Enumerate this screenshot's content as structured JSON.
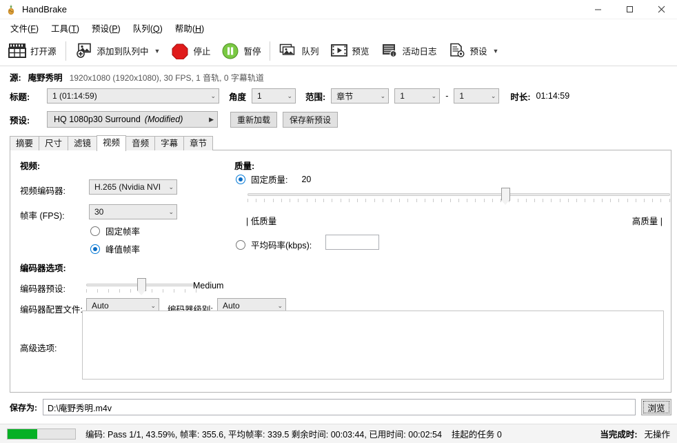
{
  "window": {
    "title": "HandBrake",
    "icon": "handbrake-pineapple-icon",
    "minimize": "—",
    "maximize": "☐",
    "close": "✕"
  },
  "menubar": [
    {
      "label": "文件",
      "accel": "F"
    },
    {
      "label": "工具",
      "accel": "T"
    },
    {
      "label": "预设",
      "accel": "P"
    },
    {
      "label": "队列",
      "accel": "Q"
    },
    {
      "label": "帮助",
      "accel": "H"
    }
  ],
  "toolbar": [
    {
      "label": "打开源",
      "icon": "film-clapper-icon",
      "caret": false
    },
    {
      "label": "添加到队列中",
      "icon": "add-to-queue-icon",
      "caret": true
    },
    {
      "label": "停止",
      "icon": "stop-octagon-icon",
      "caret": false
    },
    {
      "label": "暂停",
      "icon": "pause-circle-icon",
      "caret": false
    },
    {
      "label": "队列",
      "icon": "queue-stack-icon",
      "caret": false
    },
    {
      "label": "预览",
      "icon": "preview-film-icon",
      "caret": false
    },
    {
      "label": "活动日志",
      "icon": "activity-log-icon",
      "caret": false
    },
    {
      "label": "预设",
      "icon": "presets-gear-doc-icon",
      "caret": true
    }
  ],
  "source": {
    "label": "源:",
    "name": "庵野秀明",
    "detail": "1920x1080 (1920x1080), 30 FPS, 1 音轨, 0 字幕轨道"
  },
  "title_row": {
    "title_label": "标题:",
    "title_value": "1  (01:14:59)",
    "angle_label": "角度",
    "angle_value": "1",
    "range_label": "范围:",
    "range_value": "章节",
    "range_from": "1",
    "range_dash": "-",
    "range_to": "1",
    "duration_label": "时长:",
    "duration_value": "01:14:59"
  },
  "preset_row": {
    "label": "预设:",
    "value": "HQ 1080p30 Surround",
    "modified": "(Modified)",
    "reload_button": "重新加载",
    "save_button": "保存新预设"
  },
  "tabs": [
    {
      "label": "摘要",
      "active": false
    },
    {
      "label": "尺寸",
      "active": false
    },
    {
      "label": "滤镜",
      "active": false
    },
    {
      "label": "视频",
      "active": true
    },
    {
      "label": "音频",
      "active": false
    },
    {
      "label": "字幕",
      "active": false
    },
    {
      "label": "章节",
      "active": false
    }
  ],
  "video_tab": {
    "video_section_title": "视频:",
    "encoder_label": "视频编码器:",
    "encoder_value": "H.265 (Nvidia NVI",
    "framerate_label": "帧率 (FPS):",
    "framerate_value": "30",
    "constant_framerate": "固定帧率",
    "constant_framerate_selected": false,
    "peak_framerate": "峰值帧率",
    "peak_framerate_selected": true,
    "quality_section_title": "质量:",
    "constant_quality_label": "固定质量:",
    "constant_quality_value": "20",
    "constant_quality_selected": true,
    "quality_low_label": "| 低质量",
    "quality_high_label": "高质量 |",
    "quality_slider_percent": 61,
    "avg_bitrate_label": "平均码率(kbps):",
    "avg_bitrate_selected": false,
    "avg_bitrate_value": "",
    "encoder_options_title": "编码器选项:",
    "encoder_preset_label": "编码器预设:",
    "encoder_preset_value": "Medium",
    "encoder_preset_percent": 50,
    "encoder_profile_label": "编码器配置文件:",
    "encoder_profile_value": "Auto",
    "encoder_level_label": "编码器级别:",
    "encoder_level_value": "Auto",
    "advanced_options_label": "高级选项:",
    "advanced_options_value": ""
  },
  "save_row": {
    "label": "保存为:",
    "path": "D:\\庵野秀明.m4v",
    "browse_button": "浏览"
  },
  "statusbar": {
    "progress_percent": 43.59,
    "text": "编码: Pass 1/1, 43.59%, 帧率: 355.6, 平均帧率: 339.5 剩余时间: 00:03:44, 已用时间: 00:02:54",
    "pending_label": "挂起的任务 0",
    "when_done_label": "当完成时:",
    "when_done_value": "无操作"
  },
  "colors": {
    "accent": "#0b6cc4",
    "progress_green": "#06b025",
    "stop_red": "#e01b1b",
    "pause_green": "#7ac943"
  }
}
